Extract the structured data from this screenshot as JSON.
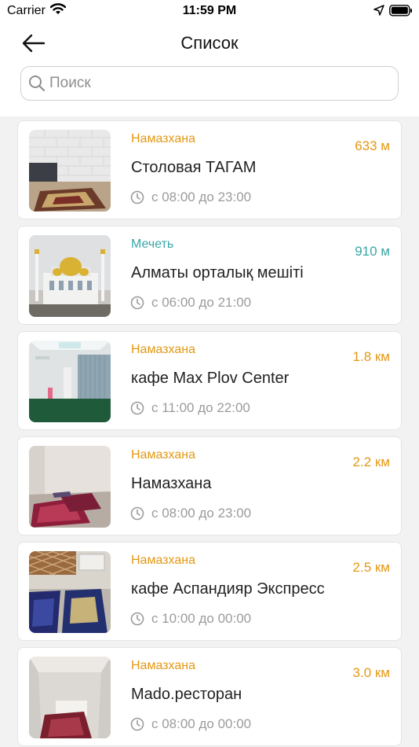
{
  "status_bar": {
    "carrier": "Carrier",
    "time": "11:59 PM"
  },
  "header": {
    "title": "Список",
    "back_icon": "arrow-left-icon"
  },
  "search": {
    "placeholder": "Поиск",
    "value": ""
  },
  "colors": {
    "namazkhana": "#e39813",
    "mosque": "#3aa6a8",
    "hours_gray": "#9b9b9b"
  },
  "places": [
    {
      "type": "Намазхана",
      "name": "Столовая ТАГАМ",
      "distance": "633 м",
      "hours": "с 08:00 до 23:00"
    },
    {
      "type": "Мечеть",
      "name": "Алматы орталық мешіті",
      "distance": "910 м",
      "hours": "с 06:00 до 21:00"
    },
    {
      "type": "Намазхана",
      "name": "кафе Max Plov Center",
      "distance": "1.8 км",
      "hours": "с 11:00 до 22:00"
    },
    {
      "type": "Намазхана",
      "name": "Намазхана",
      "distance": "2.2 км",
      "hours": "с 08:00 до 23:00"
    },
    {
      "type": "Намазхана",
      "name": "кафе Аспандияр Экспресс",
      "distance": "2.5 км",
      "hours": "с 10:00 до 00:00"
    },
    {
      "type": "Намазхана",
      "name": "Mado.ресторан",
      "distance": "3.0 км",
      "hours": "с 08:00 до 00:00"
    }
  ]
}
